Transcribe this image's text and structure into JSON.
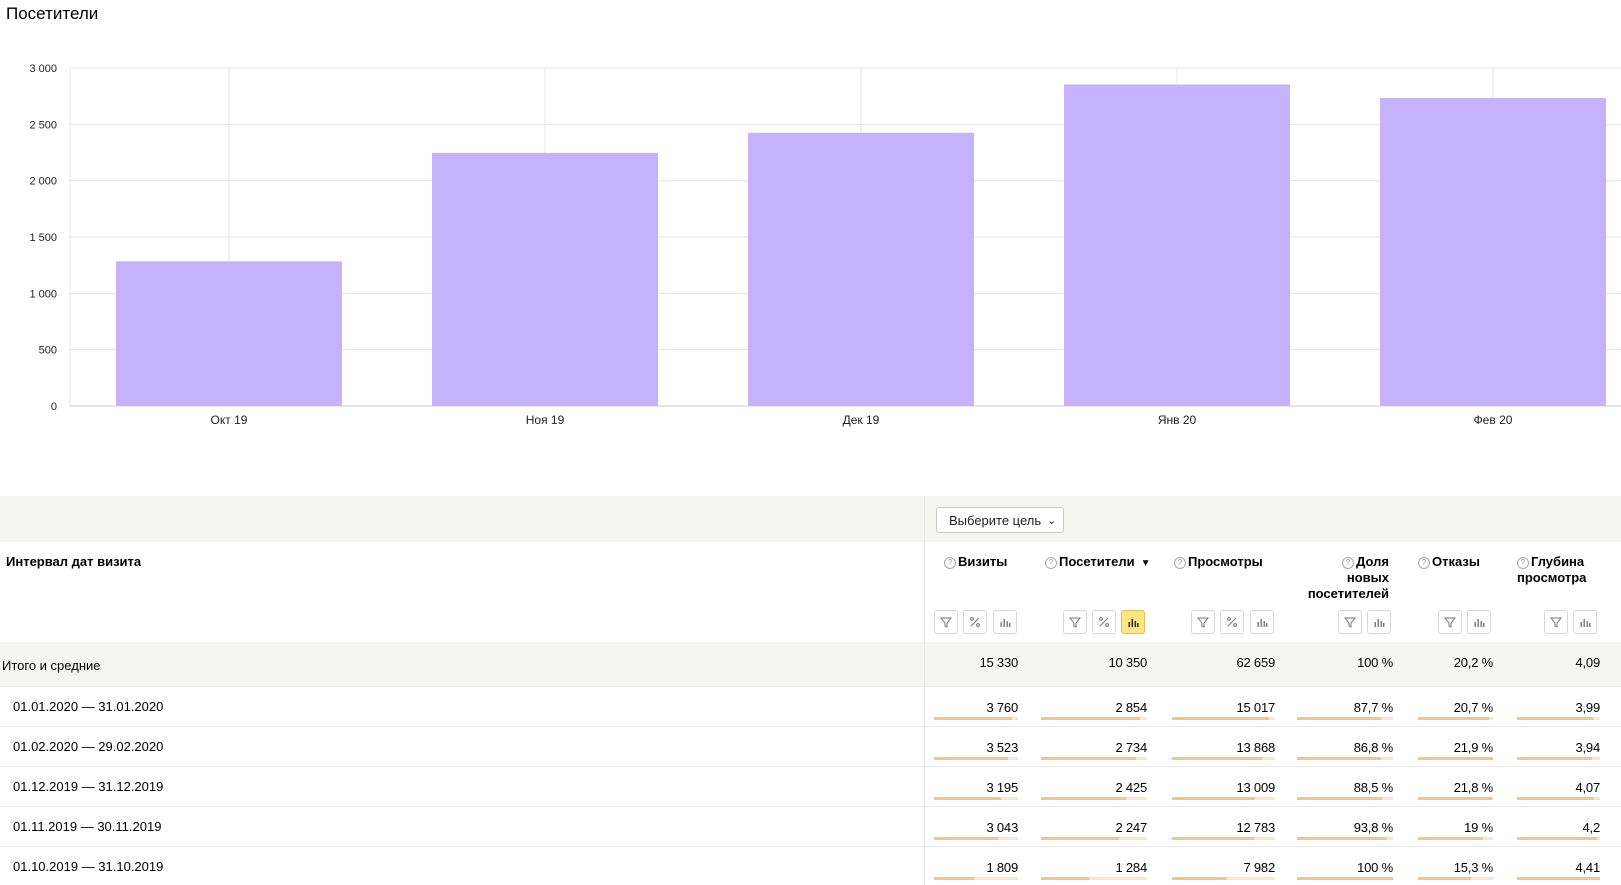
{
  "chart_data": {
    "type": "bar",
    "title": "Посетители",
    "categories": [
      "Окт 19",
      "Ноя 19",
      "Дек 19",
      "Янв 20",
      "Фев 20"
    ],
    "values": [
      1284,
      2247,
      2425,
      2854,
      2734
    ],
    "y_ticks": [
      "0",
      "500",
      "1 000",
      "1 500",
      "2 000",
      "2 500",
      "3 000"
    ],
    "ylim": [
      0,
      3000
    ],
    "grid": true,
    "bar_color": "#c4b3fa"
  },
  "table": {
    "goal_select": "Выберите цель",
    "dimension_header": "Интервал дат визита",
    "metrics": [
      {
        "label": "Визиты",
        "sorted": false
      },
      {
        "label": "Посетители",
        "sorted": true,
        "sort_mark": "▼"
      },
      {
        "label": "Просмотры",
        "sorted": false
      },
      {
        "label_lines": [
          "Доля",
          "новых",
          "посетителей"
        ],
        "sorted": false
      },
      {
        "label": "Отказы",
        "sorted": false
      },
      {
        "label_lines": [
          "Глубина",
          "просмотра"
        ],
        "sorted": false
      }
    ],
    "totals": {
      "label": "Итого и средние",
      "values": [
        "15 330",
        "10 350",
        "62 659",
        "100 %",
        "20,2 %",
        "4,09"
      ]
    },
    "rows": [
      {
        "label": "01.01.2020 — 31.01.2020",
        "values": [
          "3 760",
          "2 854",
          "15 017",
          "87,7 %",
          "20,7 %",
          "3,99"
        ],
        "fractions": [
          0.93,
          0.93,
          0.94,
          0.88,
          0.94,
          0.92
        ]
      },
      {
        "label": "01.02.2020 — 29.02.2020",
        "values": [
          "3 523",
          "2 734",
          "13 868",
          "86,8 %",
          "21,9 %",
          "3,94"
        ],
        "fractions": [
          0.88,
          0.9,
          0.87,
          0.87,
          1.0,
          0.9
        ]
      },
      {
        "label": "01.12.2019 — 31.12.2019",
        "values": [
          "3 195",
          "2 425",
          "13 009",
          "88,5 %",
          "21,8 %",
          "4,07"
        ],
        "fractions": [
          0.8,
          0.8,
          0.81,
          0.89,
          0.99,
          0.93
        ]
      },
      {
        "label": "01.11.2019 — 30.11.2019",
        "values": [
          "3 043",
          "2 247",
          "12 783",
          "93,8 %",
          "19 %",
          "4,2"
        ],
        "fractions": [
          0.76,
          0.74,
          0.8,
          0.94,
          0.87,
          0.96
        ]
      },
      {
        "label": "01.10.2019 — 31.10.2019",
        "values": [
          "1 809",
          "1 284",
          "7 982",
          "100 %",
          "15,3 %",
          "4,41"
        ],
        "fractions": [
          0.48,
          0.45,
          0.53,
          1.0,
          0.7,
          1.0
        ]
      }
    ]
  }
}
